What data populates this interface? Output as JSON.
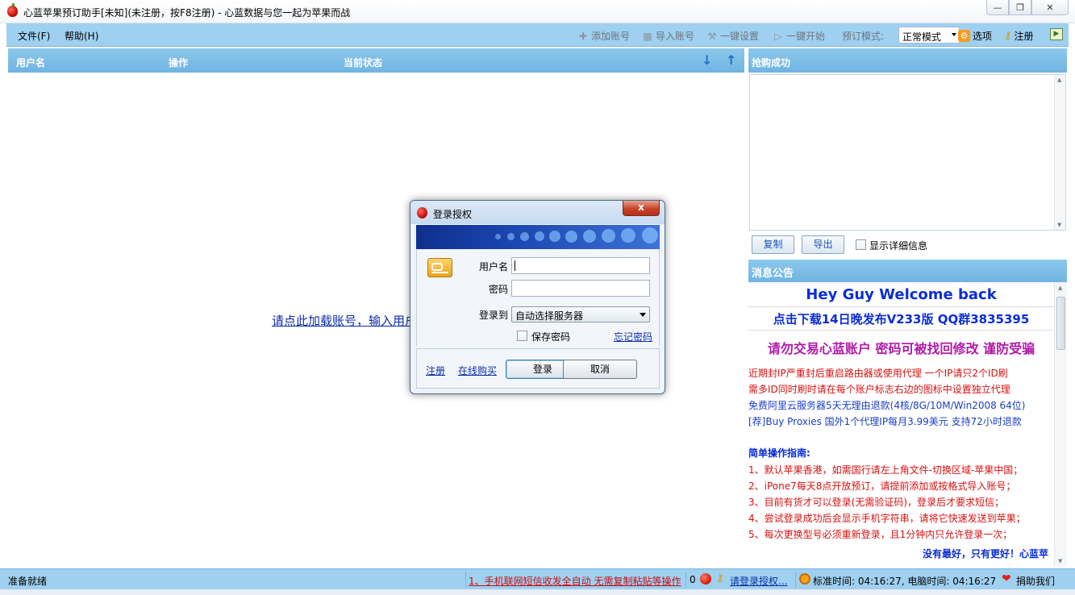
{
  "window": {
    "title": "心蓝苹果预订助手[未知](未注册，按F8注册) - 心蓝数据与您一起为苹果而战",
    "min_icon": "minimize-icon",
    "max_icon": "maximize-icon",
    "close_icon": "close-icon"
  },
  "menu": {
    "file": "文件(F)",
    "help": "帮助(H)"
  },
  "toolbar": {
    "add_account": "添加账号",
    "import_account": "导入账号",
    "one_click_settings": "一键设置",
    "one_click_start": "一键开始",
    "mode_label": "预订模式:",
    "mode_value": "正常模式",
    "options": "选项",
    "register": "注册"
  },
  "list": {
    "columns": [
      "用户名",
      "操作",
      "当前状态"
    ],
    "hint": "请点此加载账号，输入用户名和密码"
  },
  "right": {
    "success_title": "抢购成功",
    "copy": "复制",
    "export": "导出",
    "show_details": "显示详细信息",
    "notice_title": "消息公告"
  },
  "notice": {
    "welcome": "Hey Guy Welcome back",
    "download": "点击下载14日晚发布V233版  QQ群3835395",
    "warning": "请勿交易心蓝账户  密码可被找回修改  谨防受骗",
    "red1": "近期封IP严重封后重启路由器或使用代理  一个IP请只2个ID刷",
    "red2": "需多ID同时刷时请在每个账户标志右边的图标中设置独立代理",
    "blue1": "免费阿里云服务器5天无理由退款(4核/8G/10M/Win2008 64位)",
    "blue2": "[荐]Buy Proxies 国外1个代理IP每月3.99美元  支持72小时退款",
    "guide_title": "简单操作指南:",
    "guide": [
      "1、默认苹果香港，如需国行请左上角文件-切换区域-苹果中国；",
      "2、iPone7每天8点开放预订，请提前添加或按格式导入账号；",
      "3、目前有货才可以登录(无需验证码)，登录后才要求短信；",
      "4、尝试登录成功后会显示手机字符串，请将它快速发送到苹果；",
      "5、每次更换型号必须重新登录，且1分钟内只允许登录一次；"
    ],
    "slogan": "没有最好，只有更好！心蓝苹"
  },
  "status": {
    "ready": "准备就绪",
    "marquee": "1、手机联网短信收发全自动 无需复制粘贴等操作",
    "count": "0",
    "login_auth": "请登录授权...",
    "time": "标准时间: 04:16:27, 电脑时间: 04:16:27",
    "donate": "捐助我们"
  },
  "dialog": {
    "title": "登录授权",
    "close": "x",
    "username_label": "用户名",
    "password_label": "密码",
    "login_to_label": "登录到",
    "server": "自动选择服务器",
    "save_password": "保存密码",
    "forgot": "忘记密码",
    "register": "注册",
    "buy_online": "在线购买",
    "login": "登录",
    "cancel": "取消"
  }
}
